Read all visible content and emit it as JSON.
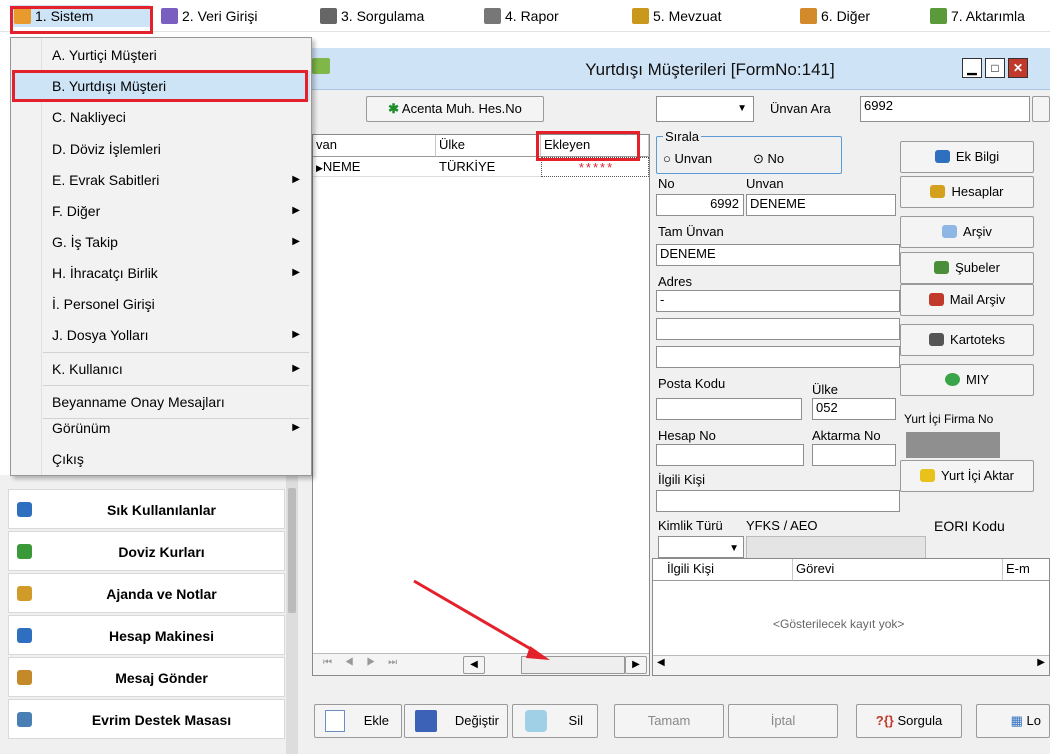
{
  "menubar": {
    "items": [
      {
        "label": "1. Sistem"
      },
      {
        "label": "2. Veri Girişi"
      },
      {
        "label": "3. Sorgulama"
      },
      {
        "label": "4. Rapor"
      },
      {
        "label": "5. Mevzuat"
      },
      {
        "label": "6. Diğer"
      },
      {
        "label": "7. Aktarımla"
      }
    ]
  },
  "sistem_menu": {
    "items": [
      {
        "label": "A.  Yurtiçi Müşteri",
        "submenu": false
      },
      {
        "label": "B.  Yurtdışı Müşteri",
        "submenu": false,
        "highlighted": true
      },
      {
        "label": "C.  Nakliyeci",
        "submenu": false
      },
      {
        "label": "D.  Döviz İşlemleri",
        "submenu": false
      },
      {
        "label": "E.  Evrak Sabitleri",
        "submenu": true
      },
      {
        "label": "F.  Diğer",
        "submenu": true
      },
      {
        "label": "G.  İş Takip",
        "submenu": true
      },
      {
        "label": "H.  İhracatçı Birlik",
        "submenu": true
      },
      {
        "label": "İ.   Personel Girişi",
        "submenu": false
      },
      {
        "label": "J.  Dosya Yolları",
        "submenu": true
      },
      {
        "label": "K.  Kullanıcı",
        "submenu": true
      },
      {
        "label": "Beyanname Onay Mesajları",
        "submenu": false
      },
      {
        "label": "Görünüm",
        "submenu": true
      },
      {
        "label": "Çıkış",
        "submenu": false
      }
    ]
  },
  "left_panel": {
    "items": [
      {
        "label": "Sık Kullanılanlar",
        "icon": "checklist-icon"
      },
      {
        "label": "Doviz Kurları",
        "icon": "currency-icon"
      },
      {
        "label": "Ajanda ve Notlar",
        "icon": "notebook-icon"
      },
      {
        "label": "Hesap Makinesi",
        "icon": "calculator-icon"
      },
      {
        "label": "Mesaj Gönder",
        "icon": "users-icon"
      },
      {
        "label": "Evrim Destek Masası",
        "icon": "support-icon"
      }
    ]
  },
  "window": {
    "title": "Yurtdışı Müşterileri [FormNo:141]",
    "acenta_button": "Acenta Muh. Hes.No",
    "unvan_ara_label": "Ünvan Ara",
    "search_value": "6992",
    "grid": {
      "headers": [
        "van",
        "Ülke",
        "Ekleyen"
      ],
      "rows": [
        [
          "NEME",
          "TÜRKİYE",
          "*****"
        ]
      ]
    },
    "sirala": {
      "title": "Sırala",
      "opt1": "Unvan",
      "opt2": "No"
    },
    "labels": {
      "no": "No",
      "unvan": "Unvan",
      "tam_unvan": "Tam Ünvan",
      "adres": "Adres",
      "posta_kodu": "Posta Kodu",
      "ulke": "Ülke",
      "hesap_no": "Hesap No",
      "aktarma_no": "Aktarma No",
      "ilgili_kisi": "İlgili Kişi",
      "kimlik_turu": "Kimlik Türü",
      "yfks": "YFKS / AEO",
      "eori": "EORI Kodu",
      "yurt_ici_firma_no": "Yurt İçi Firma No"
    },
    "values": {
      "no": "6992",
      "unvan": "DENEME",
      "tam_unvan": "DENEME",
      "adres1": "-",
      "ulke": "052"
    },
    "side_buttons": [
      "Ek Bilgi",
      "Hesaplar",
      "Arşiv",
      "Şubeler",
      "Mail Arşiv",
      "Kartoteks",
      "MIY",
      "Yurt İçi Aktar"
    ],
    "contacts_grid": {
      "headers": [
        "İlgili Kişi",
        "Görevi",
        "E-m"
      ],
      "empty_text": "<Gösterilecek kayıt yok>"
    },
    "nav_glyphs": "⏮ ◀ ▶ ⏭",
    "bottom_buttons": [
      "Ekle",
      "Değiştir",
      "Sil",
      "Tamam",
      "İptal",
      "Sorgula",
      "Lo"
    ]
  },
  "colors": {
    "highlight": "#cde4f7",
    "red_annotation": "#e4212b"
  }
}
